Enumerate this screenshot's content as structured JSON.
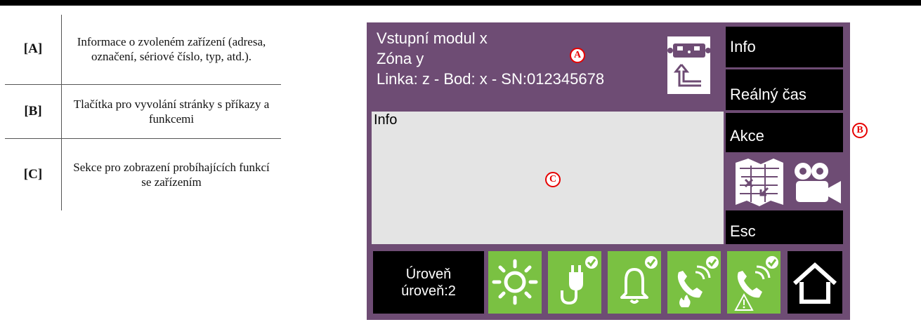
{
  "legend": [
    {
      "key": "[A]",
      "desc": "Informace o zvoleném zařízení (adresa, označení, sériové číslo, typ, atd.)."
    },
    {
      "key": "[B]",
      "desc": "Tlačítka pro vyvolání stránky s příkazy a funkcemi"
    },
    {
      "key": "[C]",
      "desc": "Sekce pro zobrazení probíhajících funkcí se zařízením"
    }
  ],
  "device": {
    "line1": "Vstupní modul x",
    "line2": "Zóna y",
    "line3": "Linka: z - Bod: x - SN:012345678",
    "icon": "input-module-icon"
  },
  "content": {
    "title": "Info"
  },
  "buttons": {
    "info": "Info",
    "realtime": "Reálný čas",
    "akce": "Akce",
    "esc": "Esc",
    "map_icon": "map-icon",
    "camera_icon": "camera-icon"
  },
  "bottom": {
    "level_line1": "Úroveň",
    "level_line2": "úroveň:2",
    "icons": [
      "sun-icon",
      "power-plug-icon",
      "bell-icon",
      "fire-phone-icon",
      "fault-phone-icon",
      "home-icon"
    ]
  },
  "markers": {
    "a": "A",
    "b": "B",
    "c": "C"
  },
  "colors": {
    "panel": "#6e4c74",
    "content": "#e4e4e4",
    "green": "#7ac142",
    "black": "#000000",
    "marker": "#e60000"
  }
}
